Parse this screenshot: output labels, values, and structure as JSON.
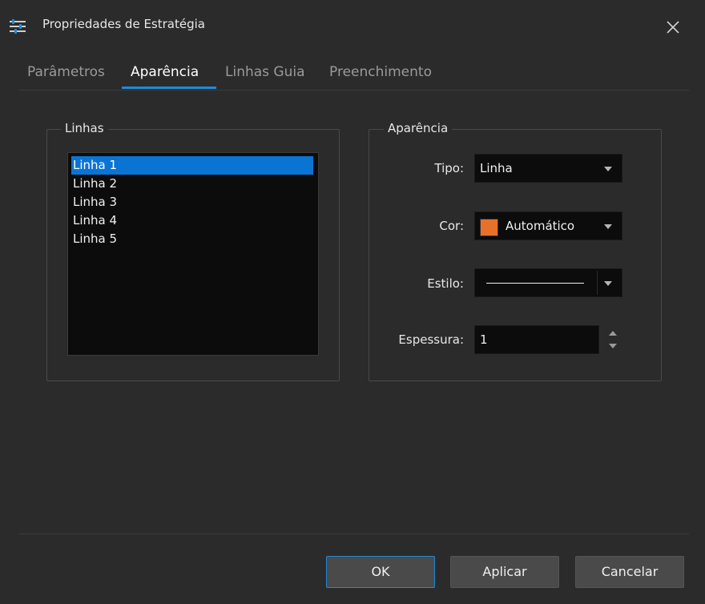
{
  "window": {
    "title": "Propriedades de Estratégia",
    "icon": "sliders-icon",
    "close_icon": "close-icon"
  },
  "tabs": [
    {
      "label": "Parâmetros",
      "active": false
    },
    {
      "label": "Aparência",
      "active": true
    },
    {
      "label": "Linhas Guia",
      "active": false
    },
    {
      "label": "Preenchimento",
      "active": false
    }
  ],
  "lines_group": {
    "label": "Linhas",
    "items": [
      "Linha 1",
      "Linha 2",
      "Linha 3",
      "Linha 4",
      "Linha 5"
    ],
    "selected": "Linha 1"
  },
  "appearance_group": {
    "label": "Aparência",
    "tipo": {
      "label": "Tipo:",
      "value": "Linha"
    },
    "cor": {
      "label": "Cor:",
      "value": "Automático",
      "swatch": "#e8712a"
    },
    "estilo": {
      "label": "Estilo:",
      "value": "solid-line"
    },
    "espessura": {
      "label": "Espessura:",
      "value": "1"
    }
  },
  "buttons": {
    "ok": "OK",
    "apply": "Aplicar",
    "cancel": "Cancelar"
  },
  "colors": {
    "accent": "#1e8ad8",
    "selection": "#0a74d4",
    "background": "#2b2b2b"
  }
}
